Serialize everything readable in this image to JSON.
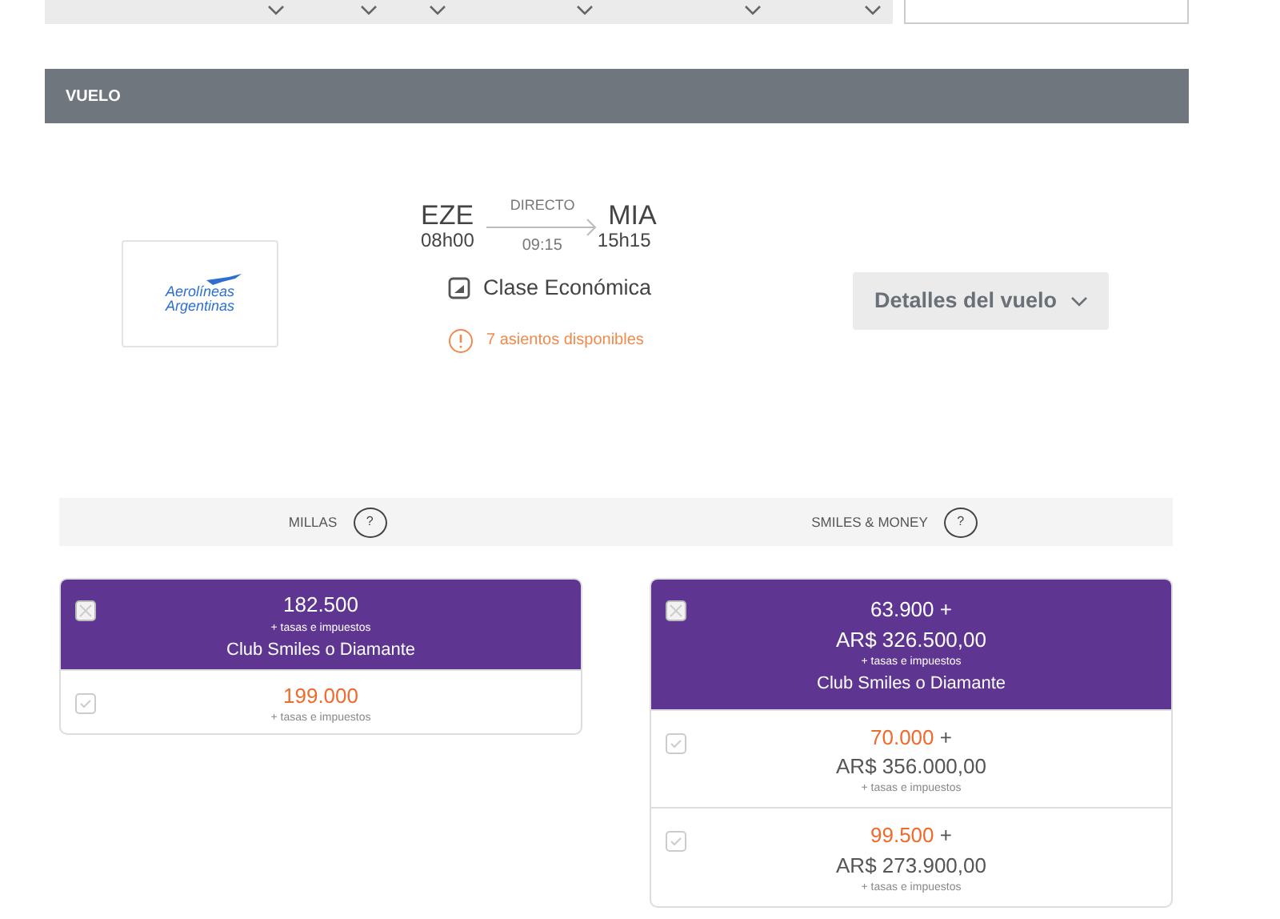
{
  "section": {
    "title": "VUELO"
  },
  "flight": {
    "airline": "Aerolíneas Argentinas",
    "origin": "EZE",
    "destination": "MIA",
    "departure": "08h00",
    "arrival": "15h15",
    "stops": "DIRECTO",
    "duration": "09:15",
    "cabin": "Clase Económica",
    "seats": "7 asientos disponibles",
    "details_button": "Detalles del vuelo"
  },
  "fare_columns": [
    {
      "title": "MILLAS",
      "help": "?",
      "options": [
        {
          "selected": true,
          "miles": "182.500",
          "taxes": "+ tasas e impuestos",
          "tier": "Club Smiles o Diamante"
        },
        {
          "selected": false,
          "miles": "199.000",
          "taxes": "+ tasas e impuestos"
        }
      ]
    },
    {
      "title": "SMILES & MONEY",
      "help": "?",
      "options": [
        {
          "selected": true,
          "miles": "63.900",
          "plus": "+",
          "money": "AR$ 326.500,00",
          "taxes": "+ tasas e impuestos",
          "tier": "Club Smiles o Diamante"
        },
        {
          "selected": false,
          "miles": "70.000",
          "plus": "+",
          "money": "AR$ 356.000,00",
          "taxes": "+ tasas e impuestos"
        },
        {
          "selected": false,
          "miles": "99.500",
          "plus": "+",
          "money": "AR$ 273.900,00",
          "taxes": "+ tasas e impuestos"
        }
      ]
    }
  ]
}
